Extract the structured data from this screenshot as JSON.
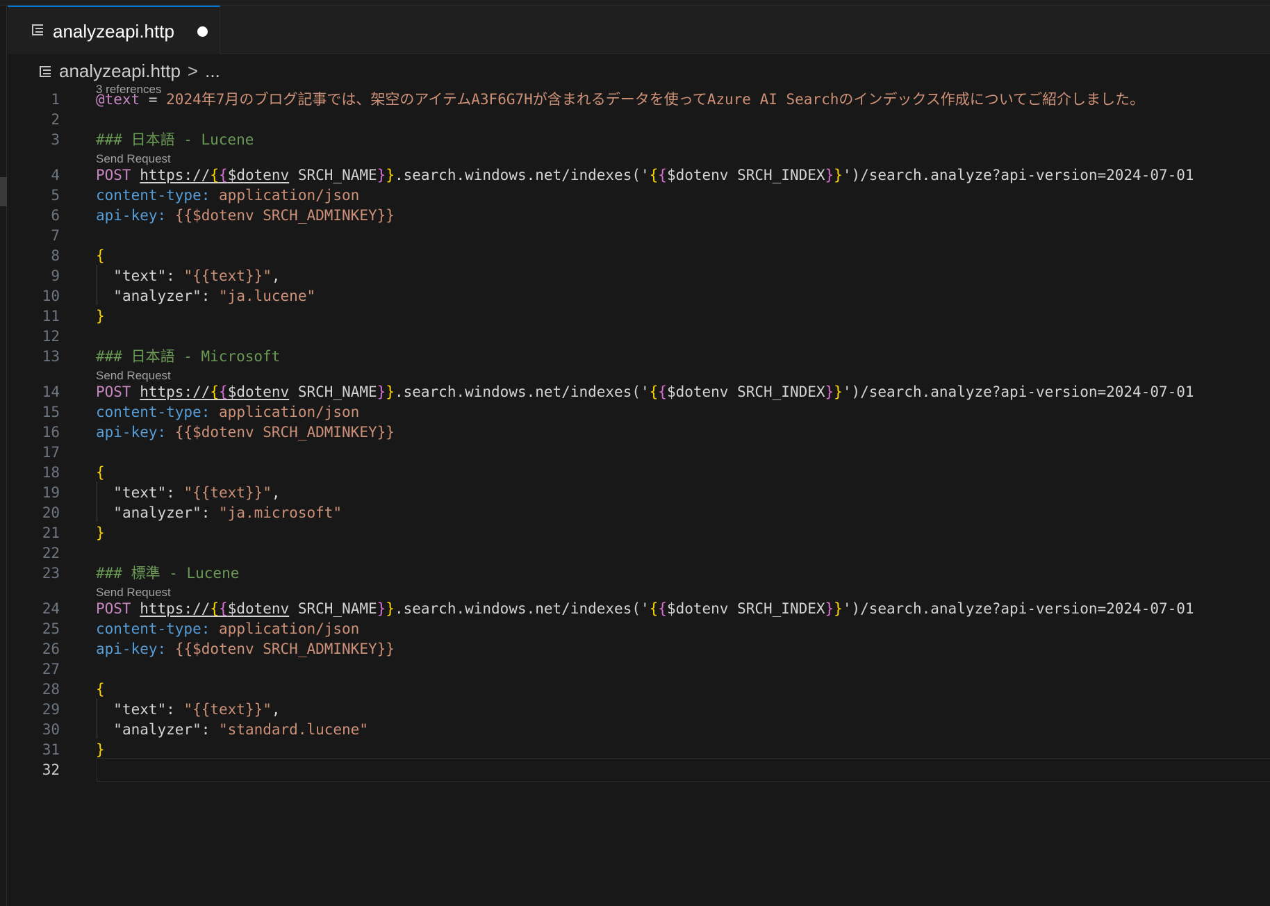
{
  "tab": {
    "title": "analyzeapi.http",
    "icon": "file-lines-icon"
  },
  "breadcrumb": {
    "file": "analyzeapi.http",
    "separator": ">",
    "more": "..."
  },
  "codelens": {
    "references": "3 references",
    "send_request": "Send Request"
  },
  "colors": {
    "background": "#181818",
    "active_tab_border": "#0078d4",
    "string": "#ce9178",
    "comment": "#6a9955",
    "variable": "#c586c0",
    "header_key": "#569cd6",
    "json_key": "#9cdcfe",
    "bracket": "#ffd700"
  },
  "line_numbers": [
    "1",
    "2",
    "3",
    "4",
    "5",
    "6",
    "7",
    "8",
    "9",
    "10",
    "11",
    "12",
    "13",
    "14",
    "15",
    "16",
    "17",
    "18",
    "19",
    "20",
    "21",
    "22",
    "23",
    "24",
    "25",
    "26",
    "27",
    "28",
    "29",
    "30",
    "31",
    "32"
  ],
  "code": {
    "var_name": "@text",
    "var_eq": " = ",
    "var_value": "2024年7月のブログ記事では、架空のアイテムA3F6G7Hが含まれるデータを使ってAzure AI Searchのインデックス作成についてご紹介しました。",
    "heading1": "### 日本語 - Lucene",
    "heading2": "### 日本語 - Microsoft",
    "heading3": "### 標準 - Lucene",
    "method": "POST",
    "url_scheme": "https://",
    "url_var1_open": "{",
    "url_var1_open2": "{",
    "url_dotenv": "$dotenv",
    "url_name": " SRCH_NAME",
    "url_var1_close": "}",
    "url_var1_close2": "}",
    "url_mid": ".search.windows.net/indexes('",
    "url_index": "$dotenv SRCH_INDEX",
    "url_tail": "')/search.analyze?api-version=2024-07-01",
    "ct_key": "content-type:",
    "ct_value": "application/json",
    "ak_key": "api-key:",
    "ak_value": "{{$dotenv SRCH_ADMINKEY}}",
    "brace_open": "{",
    "brace_close": "}",
    "json_text_key": "\"text\"",
    "json_text_value": "\"{{text}}\"",
    "json_analyzer_key": "\"analyzer\"",
    "colon": ": ",
    "comma": ",",
    "analyzer1": "\"ja.lucene\"",
    "analyzer2": "\"ja.microsoft\"",
    "analyzer3": "\"standard.lucene\""
  }
}
